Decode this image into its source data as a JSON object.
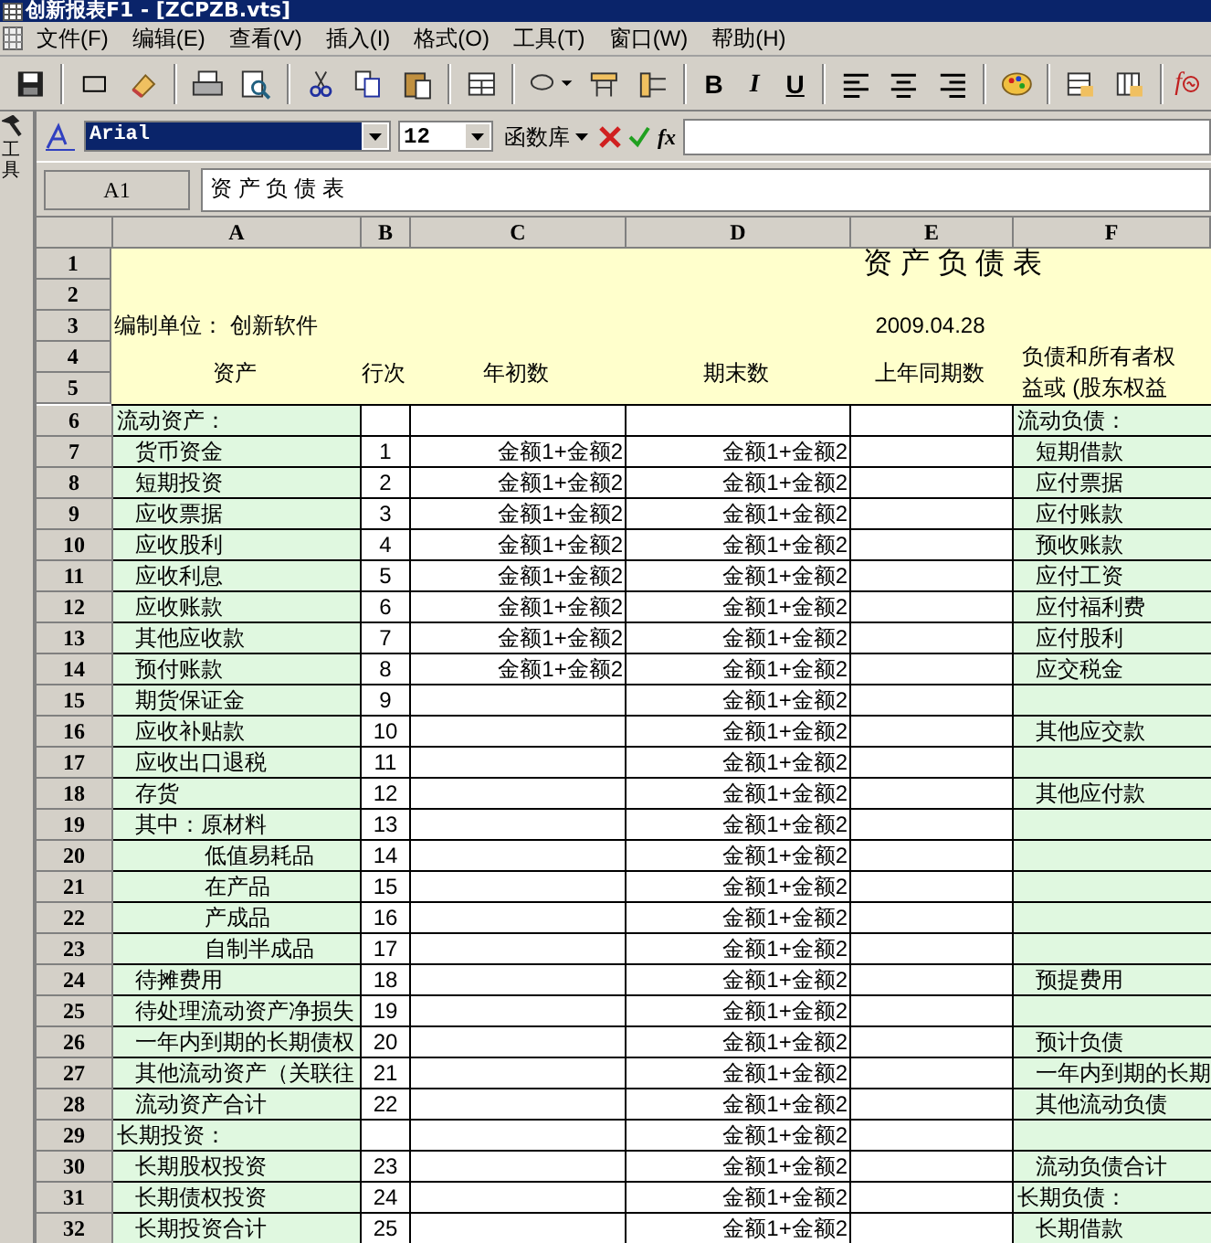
{
  "window": {
    "title": "创新报表F1 - [ZCPZB.vts]"
  },
  "menu": [
    "文件(F)",
    "编辑(E)",
    "查看(V)",
    "插入(I)",
    "格式(O)",
    "工具(T)",
    "窗口(W)",
    "帮助(H)"
  ],
  "toolbar": {
    "format_buttons": [
      "B",
      "I",
      "U"
    ],
    "function_button": "f"
  },
  "format_bar": {
    "font": "Arial",
    "size": "12",
    "function_library": "函数库",
    "fx": "fx"
  },
  "name_box": "A1",
  "cell_content": "资 产 负 债 表",
  "side_panel": {
    "label": "工具"
  },
  "sheet": {
    "columns": [
      "A",
      "B",
      "C",
      "D",
      "E",
      "F"
    ],
    "header_row_numbers": [
      "1",
      "2",
      "3",
      "4",
      "5"
    ],
    "title": "资 产 负 债 表",
    "unit": "编制单位： 创新软件",
    "date": "2009.04.28",
    "headers": [
      "资产",
      "行次",
      "年初数",
      "期末数",
      "上年同期数"
    ],
    "header_f": [
      "负债和所有者权",
      "益或 (股东权益"
    ],
    "rows": [
      {
        "num": "6",
        "a": {
          "text": "流动资产：",
          "kind": "heading"
        },
        "f": {
          "text": "流动负债：",
          "kind": "heading"
        }
      },
      {
        "num": "7",
        "a": {
          "text": "货币资金",
          "kind": "item"
        },
        "b": "1",
        "c": "金额1+金额2",
        "d": "金额1+金额2",
        "f": {
          "text": "短期借款",
          "kind": "item"
        }
      },
      {
        "num": "8",
        "a": {
          "text": "短期投资",
          "kind": "item"
        },
        "b": "2",
        "c": "金额1+金额2",
        "d": "金额1+金额2",
        "f": {
          "text": "应付票据",
          "kind": "item"
        }
      },
      {
        "num": "9",
        "a": {
          "text": "应收票据",
          "kind": "item"
        },
        "b": "3",
        "c": "金额1+金额2",
        "d": "金额1+金额2",
        "f": {
          "text": "应付账款",
          "kind": "item"
        }
      },
      {
        "num": "10",
        "a": {
          "text": "应收股利",
          "kind": "item"
        },
        "b": "4",
        "c": "金额1+金额2",
        "d": "金额1+金额2",
        "f": {
          "text": "预收账款",
          "kind": "item"
        }
      },
      {
        "num": "11",
        "a": {
          "text": "应收利息",
          "kind": "item"
        },
        "b": "5",
        "c": "金额1+金额2",
        "d": "金额1+金额2",
        "f": {
          "text": "应付工资",
          "kind": "item"
        }
      },
      {
        "num": "12",
        "a": {
          "text": "应收账款",
          "kind": "item"
        },
        "b": "6",
        "c": "金额1+金额2",
        "d": "金额1+金额2",
        "f": {
          "text": "应付福利费",
          "kind": "item"
        }
      },
      {
        "num": "13",
        "a": {
          "text": "其他应收款",
          "kind": "item"
        },
        "b": "7",
        "c": "金额1+金额2",
        "d": "金额1+金额2",
        "f": {
          "text": "应付股利",
          "kind": "item"
        }
      },
      {
        "num": "14",
        "a": {
          "text": "预付账款",
          "kind": "item"
        },
        "b": "8",
        "c": "金额1+金额2",
        "d": "金额1+金额2",
        "f": {
          "text": "应交税金",
          "kind": "item"
        }
      },
      {
        "num": "15",
        "a": {
          "text": "期货保证金",
          "kind": "item"
        },
        "b": "9",
        "d": "金额1+金额2"
      },
      {
        "num": "16",
        "a": {
          "text": "应收补贴款",
          "kind": "item"
        },
        "b": "10",
        "d": "金额1+金额2",
        "f": {
          "text": "其他应交款",
          "kind": "item"
        }
      },
      {
        "num": "17",
        "a": {
          "text": "应收出口退税",
          "kind": "item"
        },
        "b": "11",
        "d": "金额1+金额2"
      },
      {
        "num": "18",
        "a": {
          "text": "存货",
          "kind": "item"
        },
        "b": "12",
        "d": "金额1+金额2",
        "f": {
          "text": "其他应付款",
          "kind": "item"
        }
      },
      {
        "num": "19",
        "a": {
          "text": "其中：原材料",
          "kind": "item"
        },
        "b": "13",
        "d": "金额1+金额2"
      },
      {
        "num": "20",
        "a": {
          "text": "低值易耗品",
          "kind": "sub"
        },
        "b": "14",
        "d": "金额1+金额2"
      },
      {
        "num": "21",
        "a": {
          "text": "在产品",
          "kind": "sub"
        },
        "b": "15",
        "d": "金额1+金额2"
      },
      {
        "num": "22",
        "a": {
          "text": "产成品",
          "kind": "sub"
        },
        "b": "16",
        "d": "金额1+金额2"
      },
      {
        "num": "23",
        "a": {
          "text": "自制半成品",
          "kind": "sub"
        },
        "b": "17",
        "d": "金额1+金额2"
      },
      {
        "num": "24",
        "a": {
          "text": "待摊费用",
          "kind": "item"
        },
        "b": "18",
        "d": "金额1+金额2",
        "f": {
          "text": "预提费用",
          "kind": "item"
        }
      },
      {
        "num": "25",
        "a": {
          "text": "待处理流动资产净损失",
          "kind": "item"
        },
        "b": "19",
        "d": "金额1+金额2"
      },
      {
        "num": "26",
        "a": {
          "text": "一年内到期的长期债权",
          "kind": "item"
        },
        "b": "20",
        "d": "金额1+金额2",
        "f": {
          "text": "预计负债",
          "kind": "item"
        }
      },
      {
        "num": "27",
        "a": {
          "text": "其他流动资产（关联往",
          "kind": "item"
        },
        "b": "21",
        "d": "金额1+金额2",
        "f": {
          "text": "一年内到期的长期",
          "kind": "item"
        }
      },
      {
        "num": "28",
        "a": {
          "text": "流动资产合计",
          "kind": "item"
        },
        "b": "22",
        "d": "金额1+金额2",
        "f": {
          "text": "其他流动负债",
          "kind": "item"
        }
      },
      {
        "num": "29",
        "a": {
          "text": "长期投资：",
          "kind": "heading"
        },
        "d": "金额1+金额2"
      },
      {
        "num": "30",
        "a": {
          "text": "长期股权投资",
          "kind": "item"
        },
        "b": "23",
        "d": "金额1+金额2",
        "f": {
          "text": "流动负债合计",
          "kind": "item"
        }
      },
      {
        "num": "31",
        "a": {
          "text": "长期债权投资",
          "kind": "item"
        },
        "b": "24",
        "d": "金额1+金额2",
        "f": {
          "text": "长期负债：",
          "kind": "heading"
        }
      },
      {
        "num": "32",
        "a": {
          "text": "长期投资合计",
          "kind": "item"
        },
        "b": "25",
        "d": "金额1+金额2",
        "f": {
          "text": "长期借款",
          "kind": "item"
        }
      }
    ]
  }
}
